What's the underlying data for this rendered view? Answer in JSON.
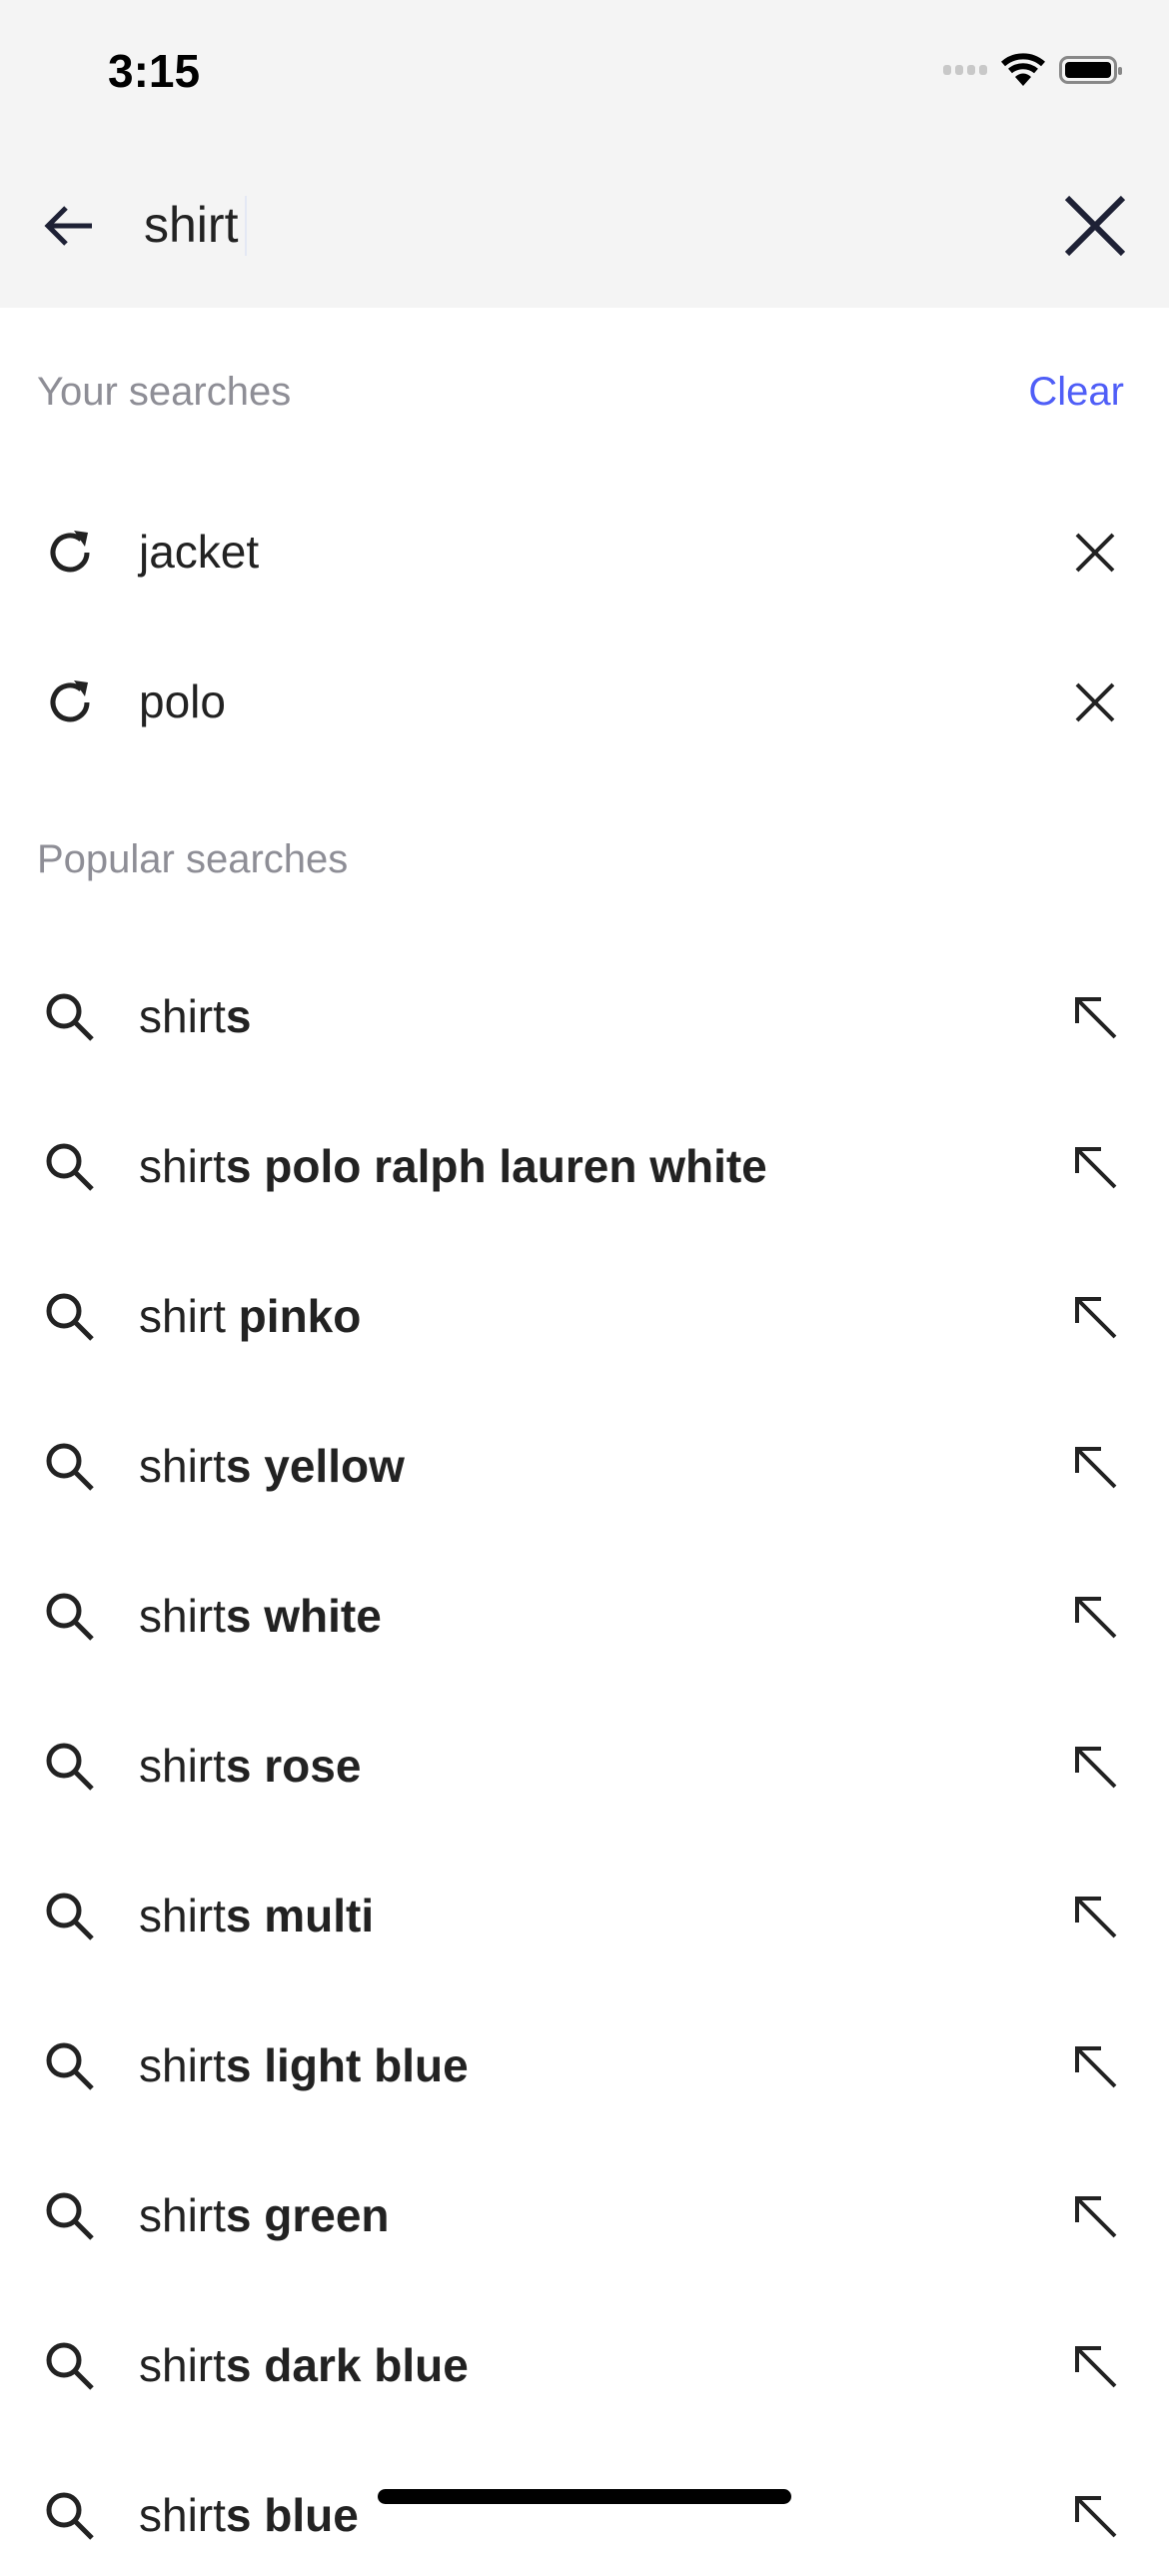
{
  "status_bar": {
    "time": "3:15"
  },
  "search": {
    "value": "shirt",
    "back_icon": "arrow-left-icon",
    "clear_icon": "close-icon"
  },
  "your_searches": {
    "title": "Your searches",
    "clear_label": "Clear",
    "accent": "#4f5ef7",
    "items": [
      {
        "label": "jacket"
      },
      {
        "label": "polo"
      }
    ]
  },
  "popular_searches": {
    "title": "Popular searches",
    "items": [
      {
        "normal": "shirt",
        "bold": "s"
      },
      {
        "normal": "shirt",
        "bold": "s polo ralph lauren white"
      },
      {
        "normal": "shirt",
        "bold": " pinko"
      },
      {
        "normal": "shirt",
        "bold": "s yellow"
      },
      {
        "normal": "shirt",
        "bold": "s white"
      },
      {
        "normal": "shirt",
        "bold": "s rose"
      },
      {
        "normal": "shirt",
        "bold": "s multi"
      },
      {
        "normal": "shirt",
        "bold": "s light blue"
      },
      {
        "normal": "shirt",
        "bold": "s green"
      },
      {
        "normal": "shirt",
        "bold": "s dark blue"
      },
      {
        "normal": "shirt",
        "bold": "s blue"
      }
    ]
  }
}
